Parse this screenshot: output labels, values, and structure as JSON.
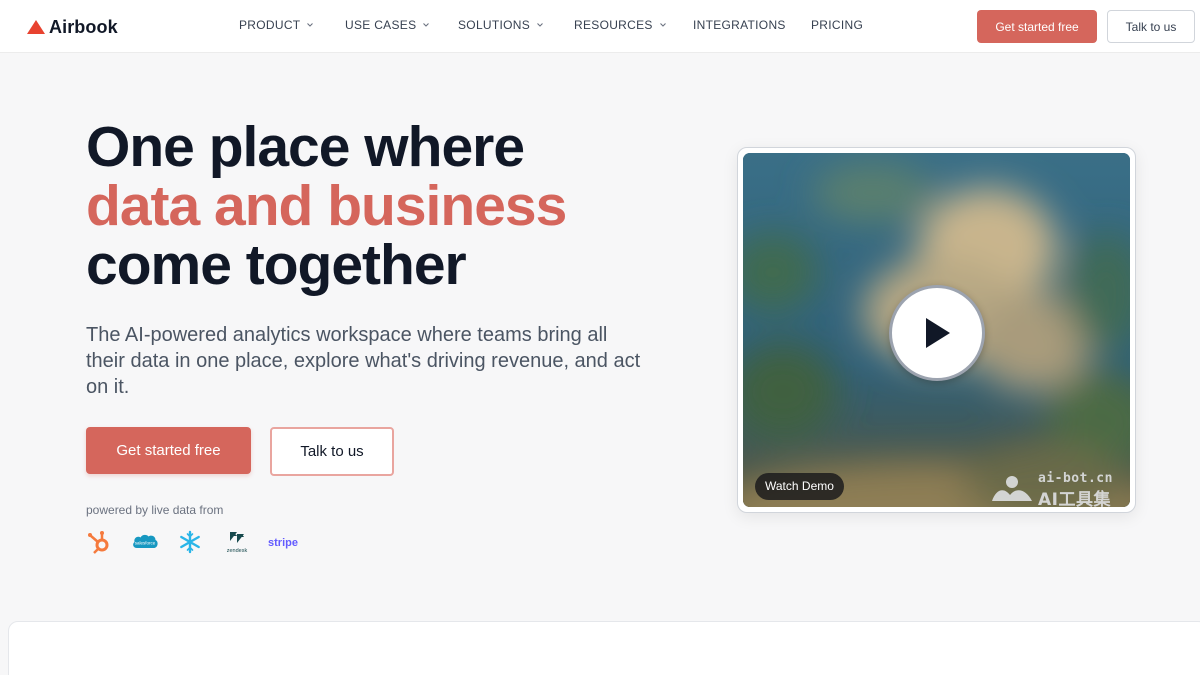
{
  "brand": {
    "name": "Airbook",
    "accent": "#d5665c"
  },
  "nav": {
    "items": [
      {
        "label": "PRODUCT",
        "has_dropdown": true
      },
      {
        "label": "USE CASES",
        "has_dropdown": true
      },
      {
        "label": "SOLUTIONS",
        "has_dropdown": true
      },
      {
        "label": "RESOURCES",
        "has_dropdown": true
      },
      {
        "label": "INTEGRATIONS",
        "has_dropdown": false
      },
      {
        "label": "PRICING",
        "has_dropdown": false
      }
    ],
    "primary_cta": "Get started free",
    "secondary_cta": "Talk to us"
  },
  "hero": {
    "title_line1": "One place where",
    "title_line2": "data and business",
    "title_line3": "come together",
    "subtitle": "The AI-powered analytics workspace where teams bring all their data in one place, explore what's driving revenue, and act on it.",
    "primary_cta": "Get started free",
    "secondary_cta": "Talk to us",
    "powered_by": "powered by live data from",
    "integrations": [
      {
        "name": "hubspot",
        "icon": "hubspot-icon",
        "color": "#f57a3d"
      },
      {
        "name": "salesforce",
        "icon": "salesforce-icon",
        "color": "#1798c1"
      },
      {
        "name": "snowflake",
        "icon": "snowflake-icon",
        "color": "#29b5e8"
      },
      {
        "name": "zendesk",
        "icon": "zendesk-icon",
        "color": "#17494d"
      },
      {
        "name": "stripe",
        "icon": "stripe-icon",
        "color": "#635bff"
      }
    ]
  },
  "video": {
    "label": "Watch Demo",
    "watermark_top": "ai-bot.cn",
    "watermark_bottom": "AI工具集"
  }
}
